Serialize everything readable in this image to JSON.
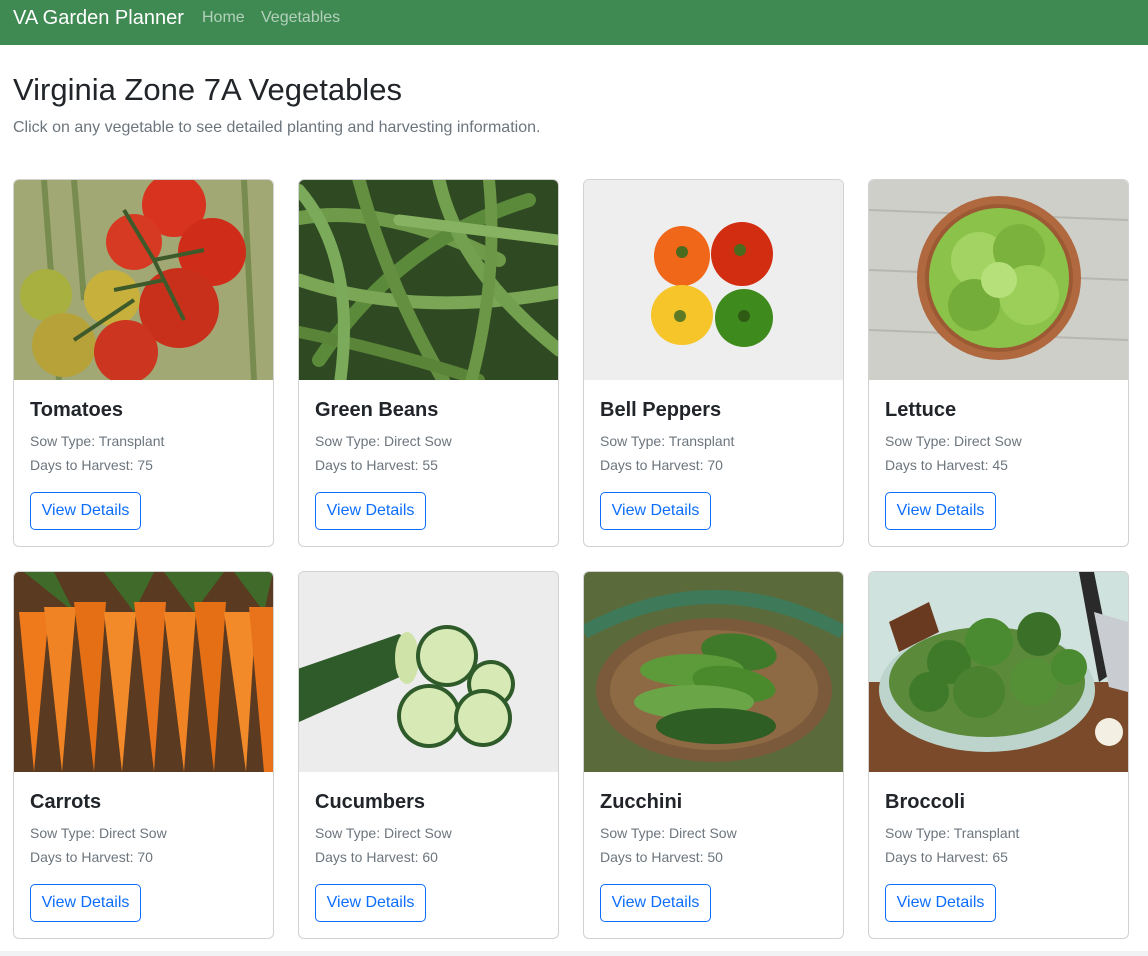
{
  "navbar": {
    "brand": "VA Garden Planner",
    "links": [
      {
        "label": "Home"
      },
      {
        "label": "Vegetables"
      }
    ],
    "color": "#3f8a53"
  },
  "page": {
    "title": "Virginia Zone 7A Vegetables",
    "subtitle": "Click on any vegetable to see detailed planting and harvesting information."
  },
  "cards": [
    {
      "name": "Tomatoes",
      "sow": "Sow Type: Transplant",
      "days": "Days to Harvest: 75",
      "button": "View Details"
    },
    {
      "name": "Green Beans",
      "sow": "Sow Type: Direct Sow",
      "days": "Days to Harvest: 55",
      "button": "View Details"
    },
    {
      "name": "Bell Peppers",
      "sow": "Sow Type: Transplant",
      "days": "Days to Harvest: 70",
      "button": "View Details"
    },
    {
      "name": "Lettuce",
      "sow": "Sow Type: Direct Sow",
      "days": "Days to Harvest: 45",
      "button": "View Details"
    },
    {
      "name": "Carrots",
      "sow": "Sow Type: Direct Sow",
      "days": "Days to Harvest: 70",
      "button": "View Details"
    },
    {
      "name": "Cucumbers",
      "sow": "Sow Type: Direct Sow",
      "days": "Days to Harvest: 60",
      "button": "View Details"
    },
    {
      "name": "Zucchini",
      "sow": "Sow Type: Direct Sow",
      "days": "Days to Harvest: 50",
      "button": "View Details"
    },
    {
      "name": "Broccoli",
      "sow": "Sow Type: Transplant",
      "days": "Days to Harvest: 65",
      "button": "View Details"
    }
  ]
}
